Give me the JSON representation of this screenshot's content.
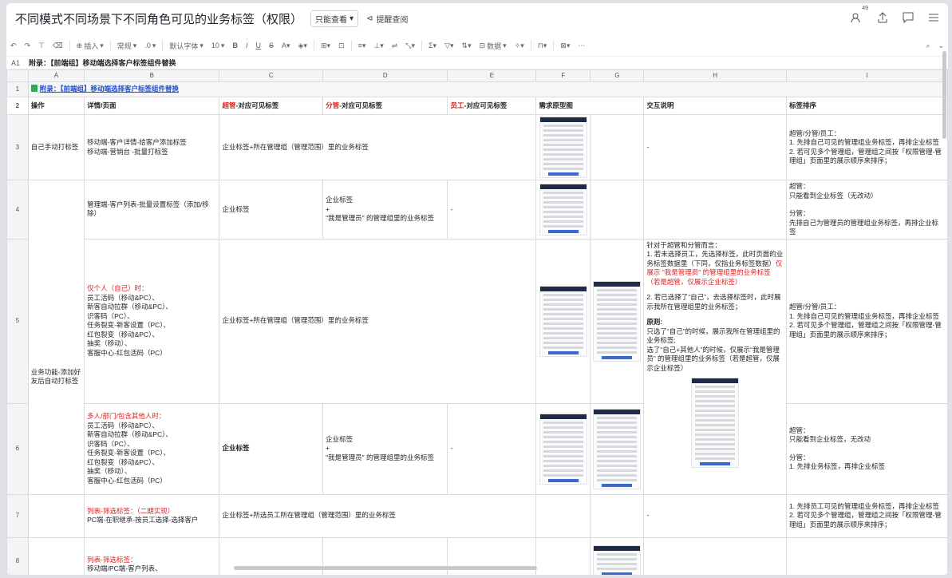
{
  "doc_title": "不同模式不同场景下不同角色可见的业务标签（权限）",
  "view_mode": "只能查看",
  "notify": "提醒查阅",
  "viewer_count": "49",
  "toolbar": {
    "insert": "插入",
    "style": "常规",
    "decimal": ".0",
    "font": "默认字体",
    "size": "10",
    "bold": "B",
    "italic": "I",
    "underline": "U",
    "strike": "S",
    "data": "数据"
  },
  "formula": {
    "ref": "A1",
    "text": "附录：【前端组】移动端选择客户标签组件替换"
  },
  "columns": [
    "A",
    "B",
    "C",
    "D",
    "E",
    "F",
    "G",
    "H",
    "I"
  ],
  "rows": [
    "1",
    "2",
    "3",
    "4",
    "5",
    "6",
    "7",
    "8"
  ],
  "r1": "附录：【前端组】移动端选择客户标签组件替换",
  "header": {
    "a": "操作",
    "b": "详情/页面",
    "c_red": "超管",
    "c_rest": "-对应可见标签",
    "d_red": "分管",
    "d_rest": "-对应可见标签",
    "e_red": "员工",
    "e_rest": "-对应可见标签",
    "f": "需求原型图",
    "h": "交互说明",
    "i": "标签排序"
  },
  "r3": {
    "a": "自己手动打标签",
    "b1": "移动端-客户详情-给客户添加标签",
    "b2": "移动端-营销台 -批量打标签",
    "c": "企业标签+所在管理组（管理范围）里的业务标签",
    "h": "-",
    "i1": "超管/分管/员工：",
    "i2": "1. 先排自己可见的管理组业务标签，再排企业标签",
    "i3": "2. 若可见多个管理组，管理组之间按「权限管理-管理组」页面里的展示顺序来排序；"
  },
  "r4": {
    "b": "管理端-客户列表-批量设置标签（添加/移除）",
    "c": "企业标签",
    "d1": "企业标签",
    "d2": "+",
    "d3": "\"我是管理员\" 的管理组里的业务标签",
    "e": "-",
    "i1": "超管：",
    "i2": "只能看到企业标签（无改动）",
    "i3": "分管：",
    "i4": "先排自己为管理员的管理组业务标签，再排企业标签"
  },
  "r5": {
    "a": "业务功能-添加好友后自动打标签",
    "b_red": "仅个人（自己）时：",
    "b1": "员工活码（移动&PC）、",
    "b2": "新客自动拉群（移动&PC）、",
    "b3": "识客码（PC）、",
    "b4": "任务裂变-新客设置（PC）、",
    "b5": "红包裂变（移动&PC）、",
    "b6": "抽奖（移动）、",
    "b7": "客服中心-红包活码（PC）",
    "c": "企业标签+所在管理组（管理范围）里的业务标签",
    "h1": "针对于超管和分管而言：",
    "h2": "1. 若未选择员工，先选择标签，此时页面的业务标签数据里（下同，仅指业务标签数据）",
    "h2_red": "仅展示 \"我是管理员\" 的管理组里的业务标签（若是超管，仅展示企业标签）",
    "h3": "2. 若已选择了“自己”，去选择标签时，此时展示我所在管理组里的业务标签；",
    "h4": "原则:",
    "h5": "只选了“自己”的时候，展示我所在管理组里的业务标签;",
    "h6": "选了“自己+其他人”的时候，仅展示“我是管理员” 的管理组里的业务标签（若是超管，仅展示企业标签）",
    "i1": "超管/分管/员工：",
    "i2": "1. 先排自己可见的管理组业务标签，再排企业标签",
    "i3": "2. 若可见多个管理组，管理组之间按「权限管理-管理组」页面里的展示顺序来排序；"
  },
  "r6": {
    "b_red": "多人/部门/包含其他人时：",
    "b1": "员工活码（移动&PC）、",
    "b2": "新客自动拉群（移动&PC）、",
    "b3": "识客码（PC）、",
    "b4": "任务裂变-新客设置（PC）、",
    "b5": "红包裂变（移动&PC）、",
    "b6": "抽奖（移动）、",
    "b7": "客服中心-红包活码（PC）",
    "c": "企业标签",
    "d1": "企业标签",
    "d2": "+",
    "d3": "\"我是管理员\" 的管理组里的业务标签",
    "e": "-",
    "i1": "超管：",
    "i2": "只能看到企业标签，无改动",
    "i3": "分管：",
    "i4": "1. 先排业务标签，再排企业标签"
  },
  "r7": {
    "b_red": "列表-筛选标签：（二期实现）",
    "b1": "PC端-在职继承-按员工选择-选择客户",
    "c": "企业标签+所选员工所在管理组（管理范围）里的业务标签",
    "h": "-",
    "i1": "1. 先排员工可见的管理组业务标签，再排企业标签",
    "i2": "2. 若可见多个管理组，管理组之间按「权限管理-管理组」页面里的展示顺序来排序；"
  },
  "r8": {
    "b_red": "列表-筛选标签：",
    "b1": "移动端/PC端-客户列表、"
  }
}
